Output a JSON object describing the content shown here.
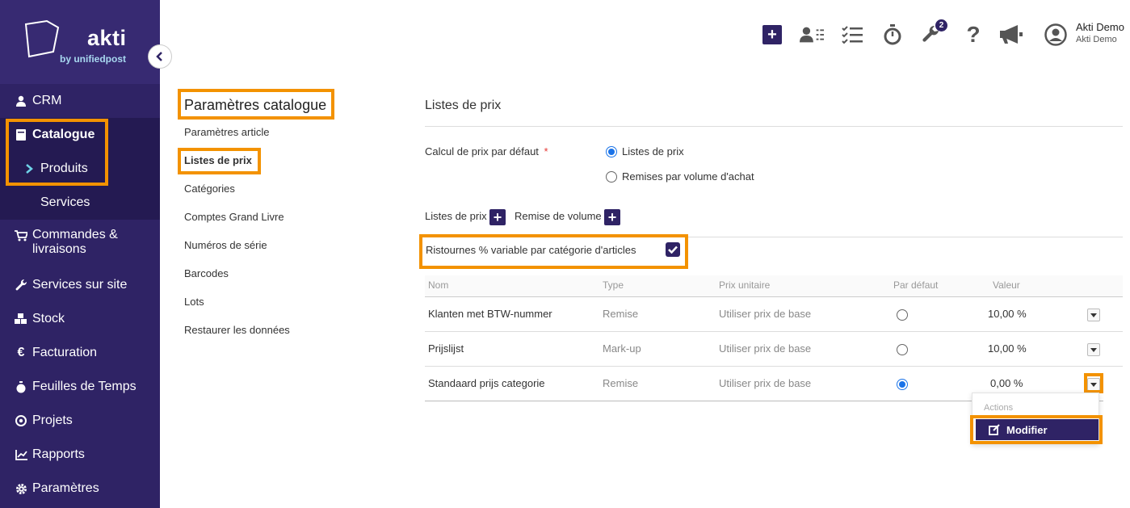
{
  "brand": {
    "name": "akti",
    "sub": "by unifiedpost"
  },
  "sidebar": {
    "items": [
      {
        "label": "CRM",
        "icon": "user-icon"
      },
      {
        "label": "Catalogue",
        "icon": "book-icon"
      },
      {
        "label": "Produits",
        "icon": "chevron-right-icon"
      },
      {
        "label": "Services",
        "icon": ""
      },
      {
        "label": "Commandes &",
        "label2": "livraisons",
        "icon": "cart-icon"
      },
      {
        "label": "Services sur site",
        "icon": "wrench-icon"
      },
      {
        "label": "Stock",
        "icon": "boxes-icon"
      },
      {
        "label": "Facturation",
        "icon": "euro-icon"
      },
      {
        "label": "Feuilles de Temps",
        "icon": "stopwatch-icon"
      },
      {
        "label": "Projets",
        "icon": "target-icon"
      },
      {
        "label": "Rapports",
        "icon": "chart-icon"
      },
      {
        "label": "Paramètres",
        "icon": "gear-icon"
      }
    ]
  },
  "topbar": {
    "badge": "2",
    "user_name": "Akti Demo",
    "user_sub": "Akti Demo"
  },
  "settings_nav": {
    "title": "Paramètres catalogue",
    "links": [
      "Paramètres article",
      "Listes de prix",
      "Catégories",
      "Comptes Grand Livre",
      "Numéros de série",
      "Barcodes",
      "Lots",
      "Restaurer les données"
    ]
  },
  "main": {
    "title": "Listes de prix",
    "calc_label": "Calcul de prix par défaut",
    "required_mark": "*",
    "radio_options": [
      "Listes de prix",
      "Remises par volume d'achat"
    ],
    "selected_option": "Listes de prix",
    "add_price_list_label": "Listes de prix",
    "add_volume_label": "Remise de volume",
    "ristournes_label": "Ristournes % variable par catégorie d'articles",
    "ristournes_checked": true,
    "table": {
      "headers": [
        "Nom",
        "Type",
        "Prix unitaire",
        "Par défaut",
        "Valeur"
      ],
      "rows": [
        {
          "nom": "Klanten met BTW-nummer",
          "type": "Remise",
          "prix": "Utiliser prix de base",
          "default": false,
          "valeur": "10,00 %"
        },
        {
          "nom": "Prijslijst",
          "type": "Mark-up",
          "prix": "Utiliser prix de base",
          "default": false,
          "valeur": "10,00 %"
        },
        {
          "nom": "Standaard prijs categorie",
          "type": "Remise",
          "prix": "Utiliser prix de base",
          "default": true,
          "valeur": "0,00 %"
        }
      ]
    },
    "actions_menu": {
      "header": "Actions",
      "item": "Modifier"
    }
  },
  "colors": {
    "sidebar": "#2f2365",
    "highlight": "#f39200",
    "radio_on": "#1a73e8"
  }
}
